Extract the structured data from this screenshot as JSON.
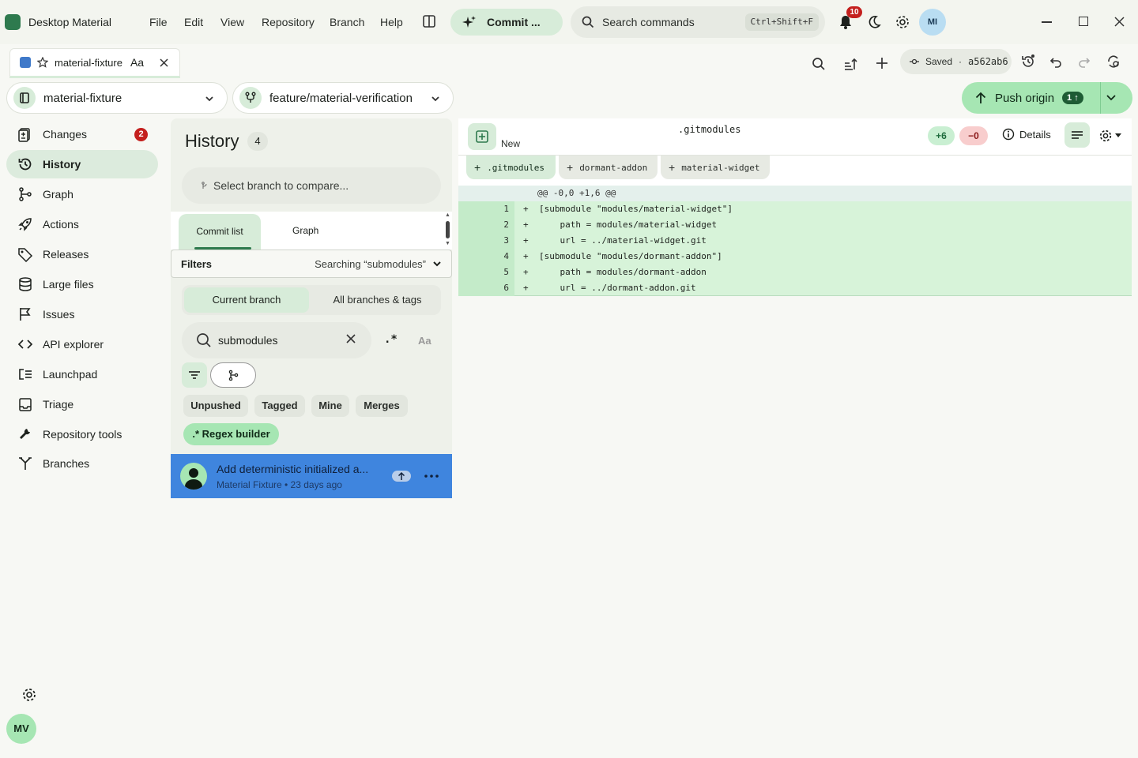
{
  "app": {
    "title": "Desktop Material"
  },
  "menu": [
    "File",
    "Edit",
    "View",
    "Repository",
    "Branch",
    "Help"
  ],
  "commit_button": {
    "label": "Commit ..."
  },
  "command_search": {
    "placeholder": "Search commands",
    "shortcut": "Ctrl+Shift+F"
  },
  "notifications": {
    "count": "10"
  },
  "user": {
    "initials_top": "MI",
    "initials_bottom": "MV"
  },
  "tab": {
    "name": "material-fixture",
    "font_toggle": "Aa"
  },
  "save_status": {
    "label": "Saved",
    "separator": "·",
    "commit": "a562ab6"
  },
  "repo_selector": {
    "name": "material-fixture"
  },
  "branch_selector": {
    "name": "feature/material-verification"
  },
  "push": {
    "label": "Push origin",
    "count": "1"
  },
  "sidebar": {
    "items": [
      {
        "label": "Changes",
        "icon": "changes-icon",
        "badge": "2"
      },
      {
        "label": "History",
        "icon": "history-icon"
      },
      {
        "label": "Graph",
        "icon": "graph-icon"
      },
      {
        "label": "Actions",
        "icon": "rocket-icon"
      },
      {
        "label": "Releases",
        "icon": "tag-icon"
      },
      {
        "label": "Large files",
        "icon": "database-icon"
      },
      {
        "label": "Issues",
        "icon": "flag-icon"
      },
      {
        "label": "API explorer",
        "icon": "code-icon"
      },
      {
        "label": "Launchpad",
        "icon": "launchpad-icon"
      },
      {
        "label": "Triage",
        "icon": "triage-icon"
      },
      {
        "label": "Repository tools",
        "icon": "wrench-icon"
      },
      {
        "label": "Branches",
        "icon": "branches-icon"
      }
    ]
  },
  "history": {
    "title": "History",
    "count": "4",
    "compare_placeholder": "Select branch to compare...",
    "tabs": [
      "Commit list",
      "Graph"
    ],
    "filters_label": "Filters",
    "filters_status": "Searching “submodules”",
    "scope": [
      "Current branch",
      "All branches & tags"
    ],
    "search_value": "submodules",
    "regex_toggle": ".*",
    "case_toggle": "Aa",
    "chips": [
      "Unpushed",
      "Tagged",
      "Mine",
      "Merges"
    ],
    "regex_builder": ".* Regex builder",
    "commit": {
      "title": "Add deterministic initialized a...",
      "meta": "Material Fixture • 23 days ago"
    }
  },
  "diff": {
    "status": "New",
    "file": ".gitmodules",
    "additions": "+6",
    "deletions": "−0",
    "details": "Details",
    "files": [
      ".gitmodules",
      "dormant-addon",
      "material-widget"
    ],
    "hunk": "@@ -0,0 +1,6 @@",
    "lines": [
      {
        "n": "1",
        "sign": "+",
        "text": "[submodule \"modules/material-widget\"]"
      },
      {
        "n": "2",
        "sign": "+",
        "text": "    path = modules/material-widget"
      },
      {
        "n": "3",
        "sign": "+",
        "text": "    url = ../material-widget.git"
      },
      {
        "n": "4",
        "sign": "+",
        "text": "[submodule \"modules/dormant-addon\"]"
      },
      {
        "n": "5",
        "sign": "+",
        "text": "    path = modules/dormant-addon"
      },
      {
        "n": "6",
        "sign": "+",
        "text": "    url = ../dormant-addon.git"
      }
    ]
  }
}
